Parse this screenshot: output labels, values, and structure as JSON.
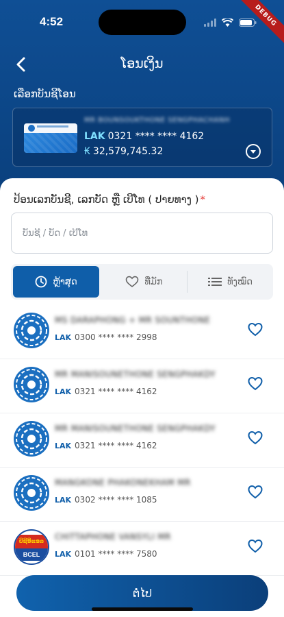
{
  "status": {
    "time": "4:52",
    "debug": "DEBUG"
  },
  "header": {
    "title": "ໂອນເງິນ"
  },
  "source": {
    "label": "ເລືອກບັນຊີໂອນ",
    "name": "MR BOUNSOUKTHONE SENGPHACHANH",
    "currency": "LAK",
    "account": "0321 **** **** 4162",
    "currency_symbol": "₭",
    "balance": "32,579,745.32"
  },
  "form": {
    "label": "ປ້ອນເລກບັນຊີ, ເລກບັດ ຫຼື ເບີໂທ ( ປາຍທາງ )",
    "required_mark": "*",
    "placeholder": "ບັນຊີ / ບັດ / ເບີໂທ"
  },
  "tabs": [
    {
      "label": "ຫຼ້າສຸດ",
      "icon": "clock-icon",
      "active": true
    },
    {
      "label": "ທີ່ມັກ",
      "icon": "heart-icon",
      "active": false
    },
    {
      "label": "ທັງໝົດ",
      "icon": "list-icon",
      "active": false
    }
  ],
  "recipients": [
    {
      "name": "MS DARAPHONG + MR SOUNTHONE",
      "currency": "LAK",
      "account": "0300 **** **** 2998",
      "bank": "bcel-one"
    },
    {
      "name": "MR MANISOUNETHONE SENGPHAKDY",
      "currency": "LAK",
      "account": "0321 **** **** 4162",
      "bank": "bcel-one"
    },
    {
      "name": "MR MANISOUNETHONE SENGPHAKDY",
      "currency": "LAK",
      "account": "0321 **** **** 4162",
      "bank": "bcel-one"
    },
    {
      "name": "MANGKONE PHAKONEKHAM MR",
      "currency": "LAK",
      "account": "0302 **** **** 1085",
      "bank": "bcel-one"
    },
    {
      "name": "CHITTAPHONE VANSYLI MR",
      "currency": "LAK",
      "account": "0101 **** **** 7580",
      "bank": "bcel"
    }
  ],
  "bcel_logo": {
    "top": "ບີຊີອີແອລ",
    "bottom": "BCEL"
  },
  "footer": {
    "next_label": "ຕໍ່ໄປ"
  },
  "colors": {
    "primary": "#0f5ea9",
    "header_bg": "#0f4f95",
    "accent_text": "#7fe0ff",
    "required": "#e53935"
  }
}
